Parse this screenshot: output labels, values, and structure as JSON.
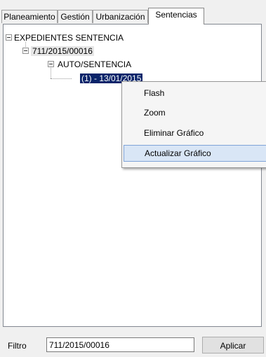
{
  "tabs": [
    {
      "label": "Planeamiento"
    },
    {
      "label": "Gestión"
    },
    {
      "label": "Urbanización"
    },
    {
      "label": "Sentencias"
    }
  ],
  "tree": {
    "root": "EXPEDIENTES SENTENCIA",
    "expediente": "711/2015/00016",
    "folder": "AUTO/SENTENCIA",
    "item": "(1) - 13/01/2015"
  },
  "context_menu": {
    "items": [
      {
        "label": "Flash"
      },
      {
        "label": "Zoom"
      },
      {
        "label": "Eliminar Gráfico"
      },
      {
        "label": "Actualizar Gráfico"
      }
    ]
  },
  "footer": {
    "filter_label": "Filtro",
    "filter_value": "711/2015/00016",
    "apply_label": "Aplicar"
  }
}
